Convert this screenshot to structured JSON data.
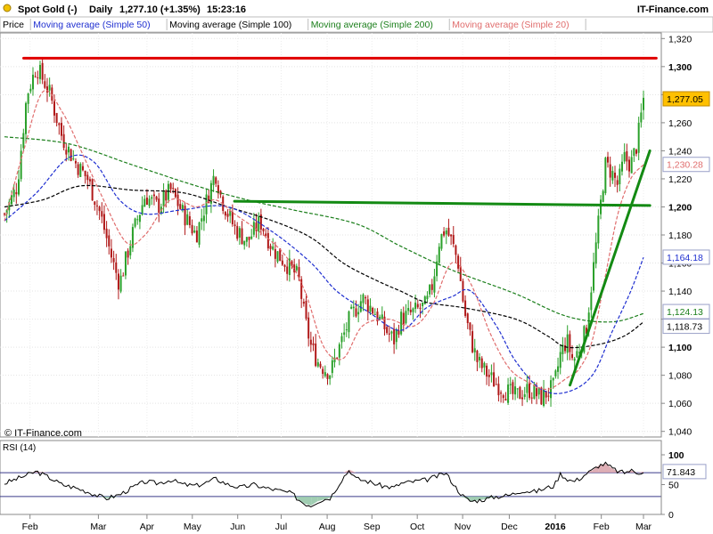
{
  "header": {
    "instrument": "Spot Gold (-)",
    "period": "Daily",
    "last": "1,277.10 (+1.35%)",
    "time": "15:23:16",
    "brand": "IT-Finance.com"
  },
  "legend_bar": {
    "items": [
      {
        "label": "Price",
        "color": "#000000"
      },
      {
        "label": "Moving average (Simple 50)",
        "color": "#1f2fd0"
      },
      {
        "label": "Moving average (Simple 100)",
        "color": "#000000"
      },
      {
        "label": "Moving average (Simple 200)",
        "color": "#1b7f1b"
      },
      {
        "label": "Moving average (Simple 20)",
        "color": "#e06d6d"
      }
    ]
  },
  "watermark": "© IT-Finance.com",
  "colors": {
    "up": "#2aa02a",
    "down": "#b01818",
    "ma50": "#1f2fd0",
    "ma100": "#000000",
    "ma200": "#1b7f1b",
    "ma20": "#e06d6d",
    "resistance": "#e00000",
    "trendline": "#138a13",
    "rsi_over": "#d8a0a8",
    "rsi_under": "#8fc4a4",
    "last_badge": "#ffc000"
  },
  "chart_data": [
    {
      "type": "candlestick",
      "title": "Spot Gold (-)",
      "ylim": [
        1036,
        1324
      ],
      "y_ticks": [
        1040,
        1060,
        1080,
        1100,
        1120,
        1140,
        1160,
        1180,
        1200,
        1220,
        1240,
        1260,
        1280,
        1300,
        1320
      ],
      "y_tick_labels": [
        "1,040",
        "1,060",
        "1,080",
        "1,100",
        "1,120",
        "1,140",
        "1,160",
        "1,180",
        "1,200",
        "1,220",
        "1,240",
        "1,260",
        "1,280",
        "1,300",
        "1,320"
      ],
      "bold_ticks": [
        "1,100",
        "1,200",
        "1,300"
      ],
      "x_months": [
        {
          "label": "Feb",
          "t": 0.04
        },
        {
          "label": "Mar",
          "t": 0.147
        },
        {
          "label": "Apr",
          "t": 0.223
        },
        {
          "label": "May",
          "t": 0.294
        },
        {
          "label": "Jun",
          "t": 0.365
        },
        {
          "label": "Jul",
          "t": 0.433
        },
        {
          "label": "Aug",
          "t": 0.505
        },
        {
          "label": "Sep",
          "t": 0.575
        },
        {
          "label": "Oct",
          "t": 0.646
        },
        {
          "label": "Nov",
          "t": 0.717
        },
        {
          "label": "Dec",
          "t": 0.79
        },
        {
          "label": "2016",
          "t": 0.862,
          "bold": true
        },
        {
          "label": "Feb",
          "t": 0.934
        },
        {
          "label": "Mar",
          "t": 1.0
        }
      ],
      "price_path": [
        [
          0.0,
          1195
        ],
        [
          0.02,
          1215
        ],
        [
          0.035,
          1280
        ],
        [
          0.05,
          1300
        ],
        [
          0.07,
          1282
        ],
        [
          0.09,
          1250
        ],
        [
          0.11,
          1232
        ],
        [
          0.13,
          1220
        ],
        [
          0.15,
          1195
        ],
        [
          0.17,
          1160
        ],
        [
          0.18,
          1145
        ],
        [
          0.2,
          1180
        ],
        [
          0.22,
          1208
        ],
        [
          0.24,
          1200
        ],
        [
          0.26,
          1212
        ],
        [
          0.28,
          1195
        ],
        [
          0.3,
          1180
        ],
        [
          0.32,
          1210
        ],
        [
          0.33,
          1225
        ],
        [
          0.34,
          1205
        ],
        [
          0.36,
          1185
        ],
        [
          0.38,
          1175
        ],
        [
          0.4,
          1190
        ],
        [
          0.42,
          1170
        ],
        [
          0.44,
          1160
        ],
        [
          0.46,
          1150
        ],
        [
          0.47,
          1120
        ],
        [
          0.48,
          1100
        ],
        [
          0.49,
          1090
        ],
        [
          0.5,
          1085
        ],
        [
          0.51,
          1082
        ],
        [
          0.52,
          1095
        ],
        [
          0.54,
          1120
        ],
        [
          0.56,
          1135
        ],
        [
          0.58,
          1125
        ],
        [
          0.6,
          1110
        ],
        [
          0.61,
          1105
        ],
        [
          0.62,
          1120
        ],
        [
          0.64,
          1125
        ],
        [
          0.66,
          1130
        ],
        [
          0.67,
          1145
        ],
        [
          0.68,
          1175
        ],
        [
          0.69,
          1185
        ],
        [
          0.7,
          1175
        ],
        [
          0.71,
          1160
        ],
        [
          0.72,
          1125
        ],
        [
          0.73,
          1105
        ],
        [
          0.74,
          1090
        ],
        [
          0.76,
          1078
        ],
        [
          0.78,
          1070
        ],
        [
          0.8,
          1065
        ],
        [
          0.82,
          1070
        ],
        [
          0.84,
          1064
        ],
        [
          0.86,
          1072
        ],
        [
          0.87,
          1095
        ],
        [
          0.88,
          1105
        ],
        [
          0.89,
          1090
        ],
        [
          0.9,
          1100
        ],
        [
          0.91,
          1112
        ],
        [
          0.92,
          1150
        ],
        [
          0.93,
          1190
        ],
        [
          0.94,
          1230
        ],
        [
          0.95,
          1225
        ],
        [
          0.96,
          1215
        ],
        [
          0.97,
          1235
        ],
        [
          0.98,
          1230
        ],
        [
          0.99,
          1245
        ],
        [
          1.0,
          1277
        ]
      ],
      "moving_averages": [
        {
          "name": "Moving average (Simple 200)",
          "color_key": "ma200",
          "points": [
            [
              0.0,
              1250
            ],
            [
              0.1,
              1245
            ],
            [
              0.2,
              1230
            ],
            [
              0.3,
              1215
            ],
            [
              0.38,
              1205
            ],
            [
              0.45,
              1198
            ],
            [
              0.55,
              1188
            ],
            [
              0.62,
              1172
            ],
            [
              0.7,
              1155
            ],
            [
              0.8,
              1138
            ],
            [
              0.88,
              1122
            ],
            [
              0.95,
              1118
            ],
            [
              1.0,
              1124
            ]
          ]
        },
        {
          "name": "Moving average (Simple 100)",
          "color_key": "ma100",
          "points": [
            [
              0.0,
              1200
            ],
            [
              0.06,
              1205
            ],
            [
              0.12,
              1215
            ],
            [
              0.2,
              1212
            ],
            [
              0.28,
              1210
            ],
            [
              0.35,
              1200
            ],
            [
              0.42,
              1190
            ],
            [
              0.48,
              1178
            ],
            [
              0.53,
              1160
            ],
            [
              0.58,
              1148
            ],
            [
              0.62,
              1140
            ],
            [
              0.66,
              1132
            ],
            [
              0.72,
              1128
            ],
            [
              0.8,
              1120
            ],
            [
              0.85,
              1108
            ],
            [
              0.88,
              1100
            ],
            [
              0.93,
              1102
            ],
            [
              0.97,
              1108
            ],
            [
              1.0,
              1118
            ]
          ]
        },
        {
          "name": "Moving average (Simple 50)",
          "color_key": "ma50",
          "points": [
            [
              0.0,
              1190
            ],
            [
              0.05,
              1210
            ],
            [
              0.1,
              1235
            ],
            [
              0.14,
              1232
            ],
            [
              0.18,
              1205
            ],
            [
              0.22,
              1195
            ],
            [
              0.28,
              1198
            ],
            [
              0.35,
              1200
            ],
            [
              0.42,
              1182
            ],
            [
              0.48,
              1160
            ],
            [
              0.52,
              1140
            ],
            [
              0.57,
              1125
            ],
            [
              0.62,
              1112
            ],
            [
              0.66,
              1128
            ],
            [
              0.7,
              1136
            ],
            [
              0.73,
              1140
            ],
            [
              0.77,
              1115
            ],
            [
              0.8,
              1090
            ],
            [
              0.84,
              1070
            ],
            [
              0.88,
              1068
            ],
            [
              0.92,
              1080
            ],
            [
              0.95,
              1110
            ],
            [
              0.98,
              1140
            ],
            [
              1.0,
              1164
            ]
          ]
        },
        {
          "name": "Moving average (Simple 20)",
          "color_key": "ma20",
          "points": [
            [
              0.0,
              1190
            ],
            [
              0.03,
              1240
            ],
            [
              0.06,
              1282
            ],
            [
              0.09,
              1268
            ],
            [
              0.12,
              1240
            ],
            [
              0.15,
              1210
            ],
            [
              0.19,
              1175
            ],
            [
              0.22,
              1180
            ],
            [
              0.26,
              1205
            ],
            [
              0.3,
              1200
            ],
            [
              0.33,
              1205
            ],
            [
              0.36,
              1195
            ],
            [
              0.4,
              1182
            ],
            [
              0.44,
              1165
            ],
            [
              0.47,
              1140
            ],
            [
              0.5,
              1100
            ],
            [
              0.53,
              1092
            ],
            [
              0.56,
              1115
            ],
            [
              0.6,
              1120
            ],
            [
              0.64,
              1115
            ],
            [
              0.67,
              1130
            ],
            [
              0.7,
              1160
            ],
            [
              0.73,
              1145
            ],
            [
              0.76,
              1110
            ],
            [
              0.79,
              1085
            ],
            [
              0.82,
              1075
            ],
            [
              0.85,
              1070
            ],
            [
              0.88,
              1078
            ],
            [
              0.9,
              1085
            ],
            [
              0.92,
              1105
            ],
            [
              0.94,
              1150
            ],
            [
              0.96,
              1195
            ],
            [
              0.98,
              1220
            ],
            [
              1.0,
              1230
            ]
          ]
        }
      ],
      "drawn_lines": [
        {
          "name": "resistance",
          "color_key": "resistance",
          "from": [
            0.03,
            1306
          ],
          "to": [
            1.02,
            1306
          ]
        },
        {
          "name": "horizontal-support",
          "color_key": "trendline",
          "from": [
            0.36,
            1204
          ],
          "to": [
            1.01,
            1201
          ]
        },
        {
          "name": "uptrend",
          "color_key": "trendline",
          "from": [
            0.885,
            1073
          ],
          "to": [
            1.01,
            1240
          ]
        }
      ],
      "price_labels": [
        {
          "text": "1,277.05",
          "value": 1277.05,
          "style": "badge"
        },
        {
          "text": "1,230.28",
          "value": 1230.28,
          "color_key": "ma20"
        },
        {
          "text": "1,164.18",
          "value": 1164.18,
          "color_key": "ma50"
        },
        {
          "text": "1,124.13",
          "value": 1124.13,
          "color_key": "ma200"
        },
        {
          "text": "1,118.73",
          "value": 1118.73,
          "color_key": "ma100"
        }
      ]
    },
    {
      "type": "line",
      "title": "RSI (14)",
      "ylim": [
        0,
        100
      ],
      "y_ticks": [
        0,
        50,
        100
      ],
      "y_tick_labels": [
        "0",
        "50",
        "100"
      ],
      "bands": [
        70,
        30
      ],
      "last_label": "71.843",
      "last_value": 71.843,
      "series": [
        [
          0.0,
          52
        ],
        [
          0.02,
          60
        ],
        [
          0.04,
          68
        ],
        [
          0.05,
          72
        ],
        [
          0.07,
          62
        ],
        [
          0.09,
          50
        ],
        [
          0.11,
          45
        ],
        [
          0.13,
          38
        ],
        [
          0.15,
          30
        ],
        [
          0.16,
          27
        ],
        [
          0.18,
          33
        ],
        [
          0.2,
          45
        ],
        [
          0.22,
          55
        ],
        [
          0.24,
          52
        ],
        [
          0.26,
          58
        ],
        [
          0.28,
          50
        ],
        [
          0.3,
          48
        ],
        [
          0.32,
          55
        ],
        [
          0.33,
          60
        ],
        [
          0.35,
          50
        ],
        [
          0.37,
          45
        ],
        [
          0.39,
          50
        ],
        [
          0.41,
          44
        ],
        [
          0.43,
          40
        ],
        [
          0.45,
          35
        ],
        [
          0.46,
          25
        ],
        [
          0.47,
          18
        ],
        [
          0.48,
          15
        ],
        [
          0.49,
          22
        ],
        [
          0.51,
          28
        ],
        [
          0.52,
          45
        ],
        [
          0.53,
          62
        ],
        [
          0.54,
          75
        ],
        [
          0.55,
          60
        ],
        [
          0.57,
          55
        ],
        [
          0.59,
          48
        ],
        [
          0.61,
          45
        ],
        [
          0.62,
          52
        ],
        [
          0.64,
          55
        ],
        [
          0.66,
          58
        ],
        [
          0.68,
          65
        ],
        [
          0.69,
          70
        ],
        [
          0.7,
          55
        ],
        [
          0.71,
          40
        ],
        [
          0.72,
          28
        ],
        [
          0.73,
          22
        ],
        [
          0.75,
          25
        ],
        [
          0.77,
          30
        ],
        [
          0.79,
          32
        ],
        [
          0.81,
          40
        ],
        [
          0.83,
          38
        ],
        [
          0.85,
          45
        ],
        [
          0.86,
          48
        ],
        [
          0.87,
          68
        ],
        [
          0.88,
          60
        ],
        [
          0.89,
          55
        ],
        [
          0.9,
          60
        ],
        [
          0.91,
          68
        ],
        [
          0.92,
          74
        ],
        [
          0.93,
          82
        ],
        [
          0.94,
          85
        ],
        [
          0.95,
          78
        ],
        [
          0.96,
          72
        ],
        [
          0.97,
          70
        ],
        [
          0.98,
          74
        ],
        [
          0.99,
          70
        ],
        [
          1.0,
          71.8
        ]
      ]
    }
  ]
}
